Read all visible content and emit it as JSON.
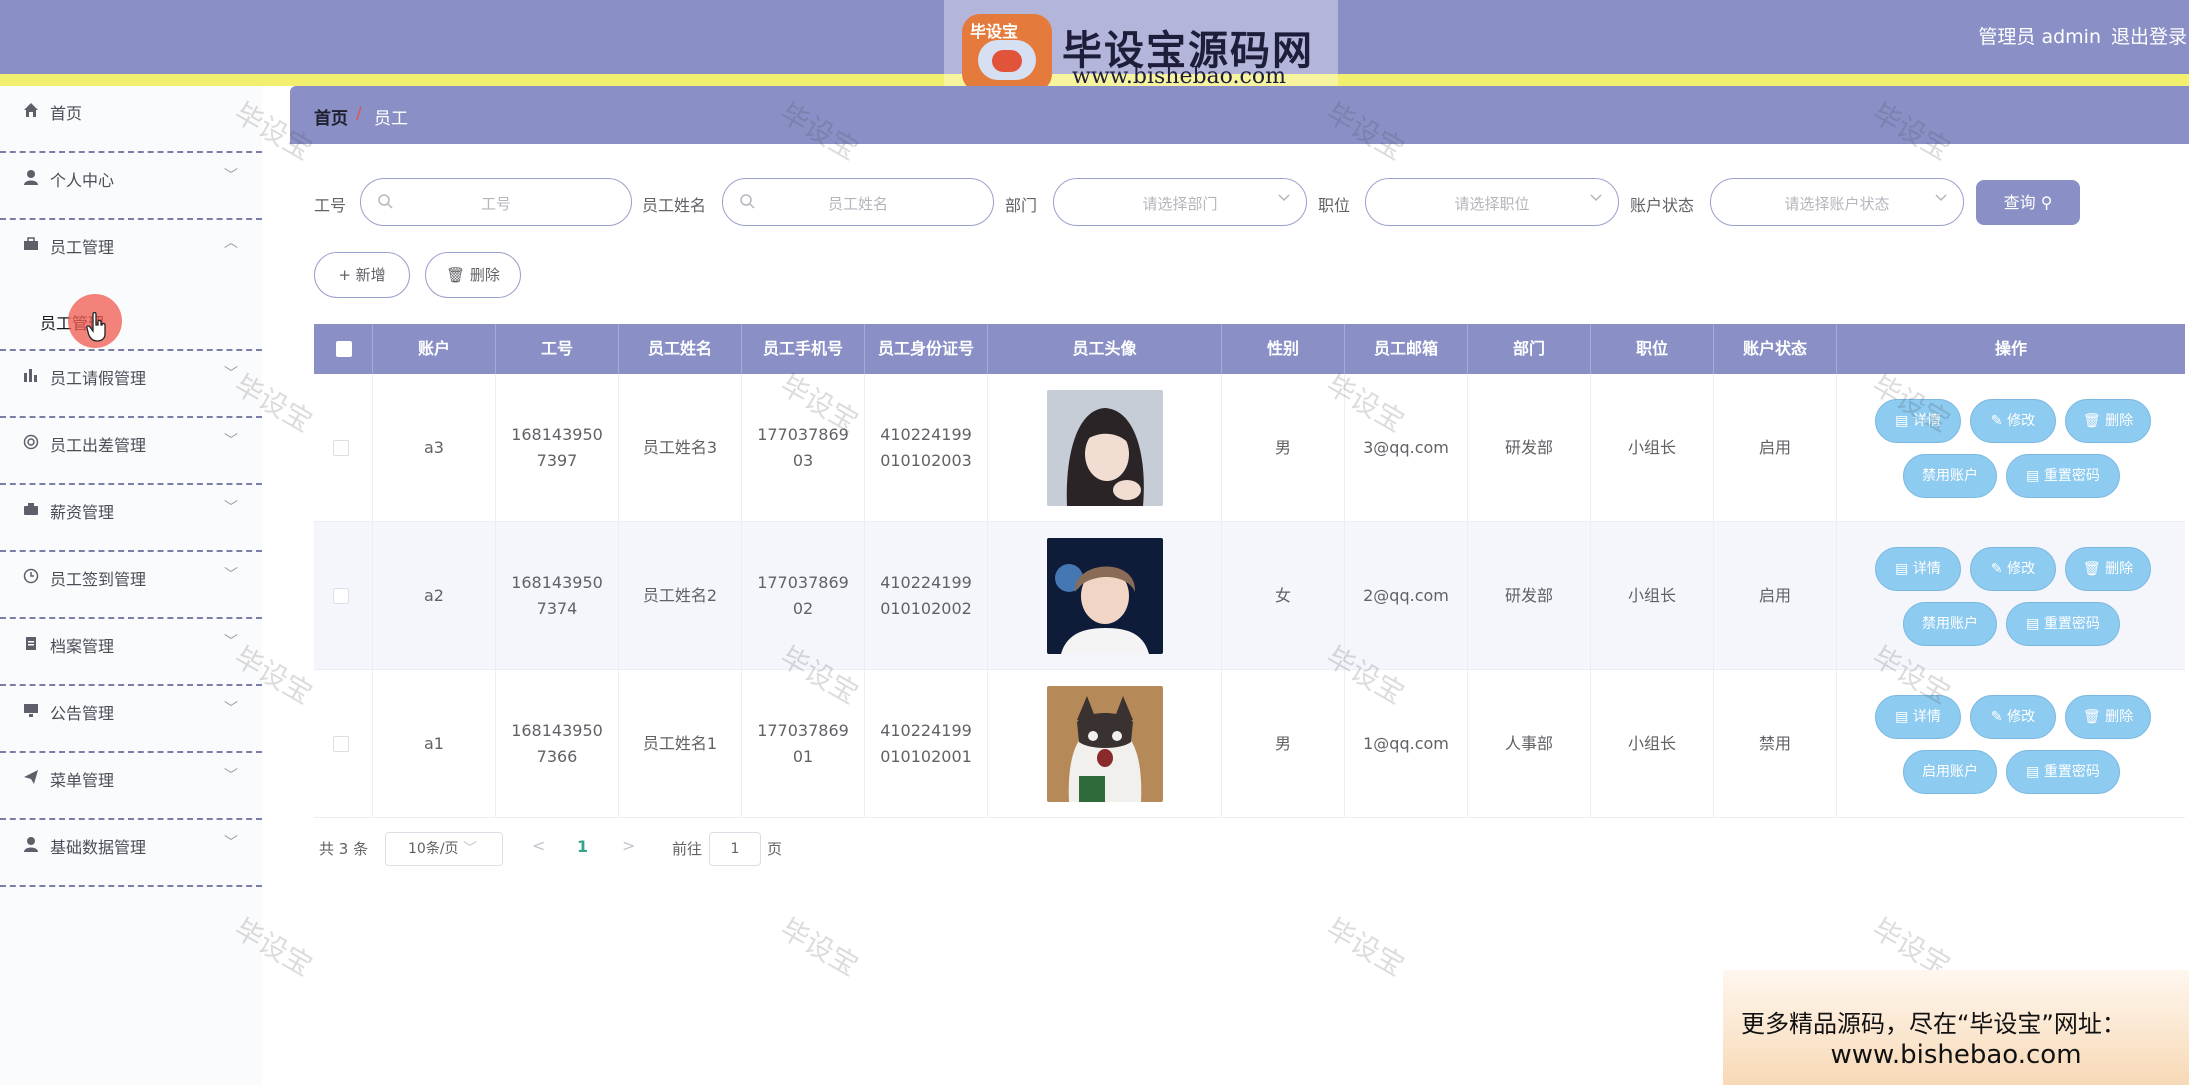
{
  "header": {
    "user_label": "管理员 admin",
    "logout_label": "退出登录",
    "logo_small": "毕设宝",
    "logo_title": "毕设宝源码网",
    "logo_url": "www.bishebao.com"
  },
  "sidebar": {
    "items": [
      {
        "label": "首页",
        "icon": "home-icon"
      },
      {
        "label": "个人中心",
        "icon": "user-icon"
      },
      {
        "label": "员工管理",
        "icon": "briefcase-icon"
      },
      {
        "label": "员工请假管理",
        "icon": "bar-chart-icon"
      },
      {
        "label": "员工出差管理",
        "icon": "globe-icon"
      },
      {
        "label": "薪资管理",
        "icon": "suitcase-icon"
      },
      {
        "label": "员工签到管理",
        "icon": "clock-icon"
      },
      {
        "label": "档案管理",
        "icon": "clipboard-icon"
      },
      {
        "label": "公告管理",
        "icon": "monitor-icon"
      },
      {
        "label": "菜单管理",
        "icon": "send-icon"
      },
      {
        "label": "基础数据管理",
        "icon": "user-icon"
      }
    ],
    "submenu_label": "员工管理"
  },
  "breadcrumb": {
    "home": "首页",
    "separator": "/",
    "current": "员工"
  },
  "filters": {
    "job_no_label": "工号",
    "job_no_placeholder": "工号",
    "name_label": "员工姓名",
    "name_placeholder": "员工姓名",
    "dept_label": "部门",
    "dept_placeholder": "请选择部门",
    "position_label": "职位",
    "position_placeholder": "请选择职位",
    "status_label": "账户状态",
    "status_placeholder": "请选择账户状态",
    "query_label": "查询"
  },
  "toolbar": {
    "add_label": "+ 新增",
    "delete_label": "删除"
  },
  "table": {
    "headers": [
      "账户",
      "工号",
      "员工姓名",
      "员工手机号",
      "员工身份证号",
      "员工头像",
      "性别",
      "员工邮箱",
      "部门",
      "职位",
      "账户状态",
      "操作"
    ],
    "rows": [
      {
        "account": "a3",
        "job_no": "1681439507397",
        "name": "员工姓名3",
        "phone": "17703786903",
        "id_card": "410224199010102003",
        "gender": "男",
        "email": "3@qq.com",
        "dept": "研发部",
        "position": "小组长",
        "status": "启用",
        "toggle_label": "禁用账户"
      },
      {
        "account": "a2",
        "job_no": "1681439507374",
        "name": "员工姓名2",
        "phone": "17703786902",
        "id_card": "410224199010102002",
        "gender": "女",
        "email": "2@qq.com",
        "dept": "研发部",
        "position": "小组长",
        "status": "启用",
        "toggle_label": "禁用账户"
      },
      {
        "account": "a1",
        "job_no": "1681439507366",
        "name": "员工姓名1",
        "phone": "17703786901",
        "id_card": "410224199010102001",
        "gender": "男",
        "email": "1@qq.com",
        "dept": "人事部",
        "position": "小组长",
        "status": "禁用",
        "toggle_label": "启用账户"
      }
    ],
    "actions": {
      "detail": "详情",
      "edit": "修改",
      "delete": "删除",
      "reset": "重置密码"
    }
  },
  "pagination": {
    "total": "共 3 条",
    "page_size": "10条/页",
    "current_page": "1",
    "goto_label": "前往",
    "goto_value": "1",
    "page_suffix": "页"
  },
  "watermark": "毕设宝",
  "promo": {
    "line1": "更多精品源码，尽在“毕设宝”网址：",
    "line2": "www.bishebao.com"
  },
  "colors": {
    "header": "#8a90c6",
    "stripe": "#f3ef6e",
    "action_button": "#8ecbf0",
    "current_page": "#37a58a"
  }
}
